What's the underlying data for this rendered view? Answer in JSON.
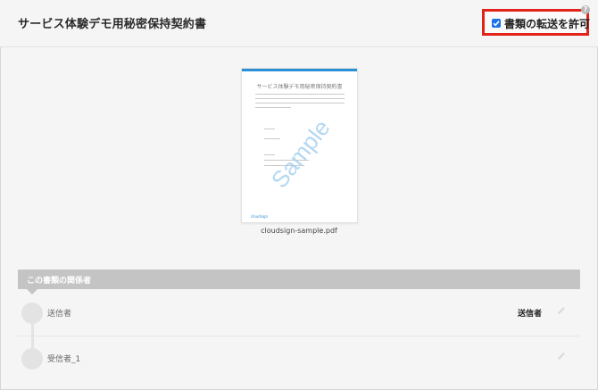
{
  "header": {
    "title": "サービス体験デモ用秘密保持契約書",
    "allow_transfer_label": "書類の転送を許可",
    "allow_transfer_checked": true,
    "help_icon_text": "?"
  },
  "preview": {
    "doc_title": "サービス体験デモ用秘密保持契約書",
    "watermark": "Sample",
    "footer_logo": "cloudsign",
    "filename": "cloudsign-sample.pdf"
  },
  "parties": {
    "section_title": "この書類の関係者",
    "rows": [
      {
        "name": "送信者",
        "role": "送信者"
      },
      {
        "name": "受信者_1",
        "role": ""
      }
    ]
  },
  "colors": {
    "accent_red": "#e2231a",
    "checkbox_blue": "#1a73e8",
    "section_gray": "#c4c4c4",
    "preview_blue": "#2c8fd6"
  },
  "icons": [
    "check-icon",
    "help-icon",
    "pencil-icon"
  ]
}
